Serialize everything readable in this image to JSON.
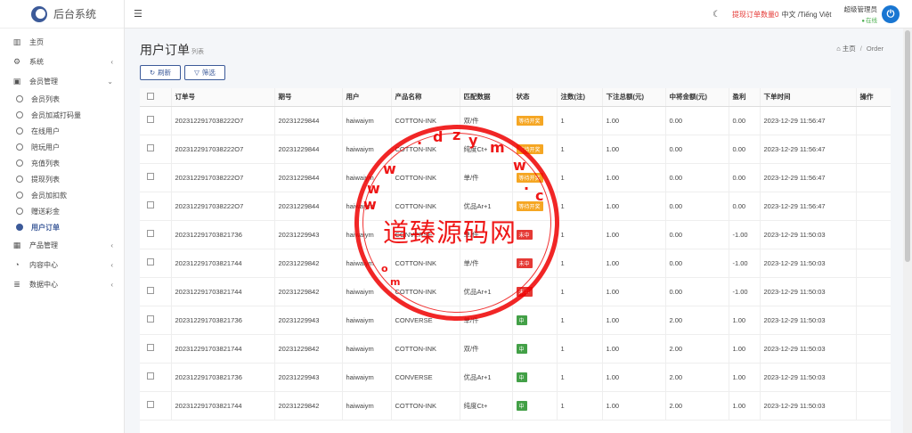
{
  "brand": {
    "name": "后台系统"
  },
  "sidebar": {
    "items": [
      {
        "label": "主页",
        "icon": "bar-chart-icon"
      },
      {
        "label": "系统",
        "icon": "gear-icon",
        "arrow": "‹"
      },
      {
        "label": "会员管理",
        "icon": "id-card-icon",
        "arrow": "⌄"
      }
    ],
    "sub_items": [
      {
        "label": "会员列表"
      },
      {
        "label": "会员加减打码量"
      },
      {
        "label": "在线用户"
      },
      {
        "label": "陪玩用户"
      },
      {
        "label": "充值列表"
      },
      {
        "label": "提现列表"
      },
      {
        "label": "会员加扣款"
      },
      {
        "label": "赠送彩金"
      },
      {
        "label": "用户订单",
        "active": true
      }
    ],
    "bottom_items": [
      {
        "label": "产品管理",
        "icon": "grid-icon",
        "arrow": "‹"
      },
      {
        "label": "内容中心",
        "icon": "chat-icon",
        "arrow": "‹"
      },
      {
        "label": "数据中心",
        "icon": "database-icon",
        "arrow": "‹"
      }
    ]
  },
  "topbar": {
    "withdraw_label": "提现订单数量0",
    "lang": "中文 /Tiếng Việt",
    "user_name": "超级管理员",
    "user_status": "在线"
  },
  "page": {
    "title": "用户订单",
    "subtitle": "列表",
    "breadcrumb_home": "主页",
    "breadcrumb_sep": "/",
    "breadcrumb_current": "Order"
  },
  "toolbar": {
    "refresh_label": "刷新",
    "filter_label": "筛选"
  },
  "table": {
    "columns": [
      "订单号",
      "期号",
      "用户",
      "产品名称",
      "匹配数据",
      "状态",
      "注数(注)",
      "下注总额(元)",
      "中将金额(元)",
      "盈利",
      "下单时间",
      "操作"
    ],
    "rows": [
      [
        "2023122917038222O7",
        "20231229844",
        "haiwaiym",
        "COTTON-INK",
        "双/件",
        "等待开奖",
        "1",
        "1.00",
        "0.00",
        "0.00",
        "2023-12-29 11:56:47"
      ],
      [
        "2023122917038222O7",
        "20231229844",
        "haiwaiym",
        "COTTON-INK",
        "纯度Ct+",
        "等待开奖",
        "1",
        "1.00",
        "0.00",
        "0.00",
        "2023-12-29 11:56:47"
      ],
      [
        "2023122917038222O7",
        "20231229844",
        "haiwaiym",
        "COTTON-INK",
        "单/件",
        "等待开奖",
        "1",
        "1.00",
        "0.00",
        "0.00",
        "2023-12-29 11:56:47"
      ],
      [
        "2023122917038222O7",
        "20231229844",
        "haiwaiym",
        "COTTON-INK",
        "优品Ar+1",
        "等待开奖",
        "1",
        "1.00",
        "0.00",
        "0.00",
        "2023-12-29 11:56:47"
      ],
      [
        "2023122917038217З6",
        "20231229943",
        "haiwaiym",
        "CONVERSE",
        "单/件",
        "未中",
        "1",
        "1.00",
        "0.00",
        "-1.00",
        "2023-12-29 11:50:03"
      ],
      [
        "202312291703821744",
        "20231229842",
        "haiwaiym",
        "COTTON-INK",
        "单/件",
        "未中",
        "1",
        "1.00",
        "0.00",
        "-1.00",
        "2023-12-29 11:50:03"
      ],
      [
        "202312291703821744",
        "20231229842",
        "haiwaiym",
        "COTTON-INK",
        "优品Ar+1",
        "未中",
        "1",
        "1.00",
        "0.00",
        "-1.00",
        "2023-12-29 11:50:03"
      ],
      [
        "2023122917038217З6",
        "20231229943",
        "haiwaiym",
        "CONVERSE",
        "单/件",
        "中",
        "1",
        "1.00",
        "2.00",
        "1.00",
        "2023-12-29 11:50:03"
      ],
      [
        "202312291703821744",
        "20231229842",
        "haiwaiym",
        "COTTON-INK",
        "双/件",
        "中",
        "1",
        "1.00",
        "2.00",
        "1.00",
        "2023-12-29 11:50:03"
      ],
      [
        "2023122917038217З6",
        "20231229943",
        "haiwaiym",
        "CONVERSE",
        "优品Ar+1",
        "中",
        "1",
        "1.00",
        "2.00",
        "1.00",
        "2023-12-29 11:50:03"
      ],
      [
        "202312291703821744",
        "20231229842",
        "haiwaiym",
        "COTTON-INK",
        "纯度Ct+",
        "中",
        "1",
        "1.00",
        "2.00",
        "1.00",
        "2023-12-29 11:50:03"
      ]
    ]
  },
  "watermark": {
    "text": "道臻源码网",
    "url": "www.dzymw.com"
  },
  "colors": {
    "accent": "#3c5a99",
    "pending": "#f5a623",
    "lose": "#e53935",
    "win": "#43a047",
    "danger": "#e53935",
    "online": "#4caf50"
  }
}
